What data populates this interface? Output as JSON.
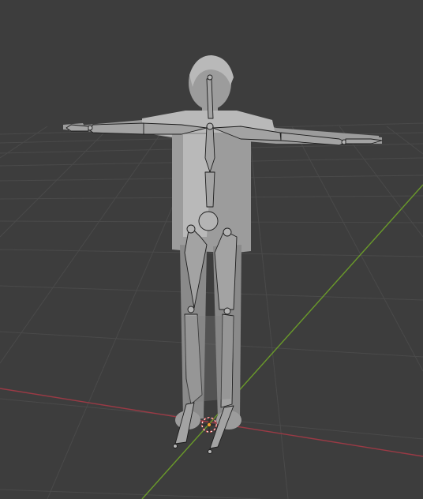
{
  "app": "Blender",
  "viewport": {
    "background": "#3d3d3d",
    "grid_color": "#4a4a4a",
    "x_axis_color": "#9a3a45",
    "y_axis_color": "#6a9a2a",
    "mesh_color": "#9c9c9c",
    "bone_color": "#a3a3a3",
    "cursor_color": "#d84a4a"
  }
}
